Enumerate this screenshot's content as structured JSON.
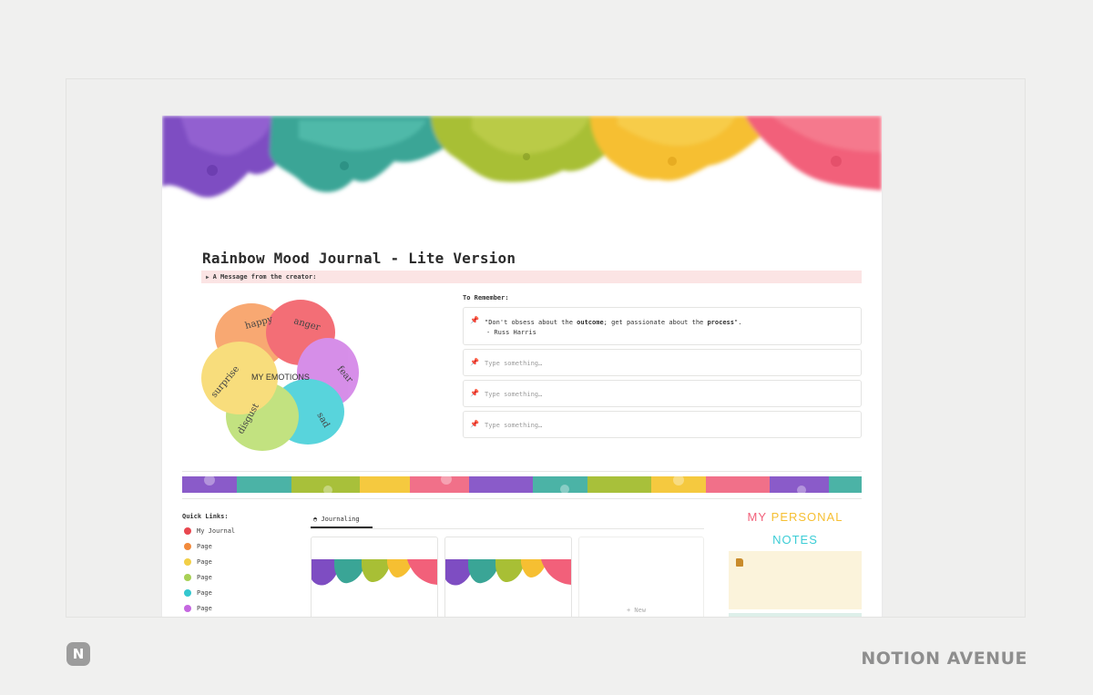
{
  "page": {
    "title": "Rainbow Mood Journal - Lite Version",
    "creator_toggle": "A Message from the creator:",
    "emotions_wheel": {
      "center_label": "MY EMOTIONS",
      "petals": [
        {
          "label": "happy",
          "color": "#f79a5a"
        },
        {
          "label": "anger",
          "color": "#f2555f"
        },
        {
          "label": "fear",
          "color": "#d07be5"
        },
        {
          "label": "sad",
          "color": "#3ccdd6"
        },
        {
          "label": "disgust",
          "color": "#b8dd6a"
        },
        {
          "label": "surprise",
          "color": "#f7d866"
        }
      ]
    },
    "to_remember": {
      "label": "To Remember:",
      "quote_pre": "\"Don't obsess about the ",
      "quote_bold1": "outcome",
      "quote_mid": "; get passionate about the ",
      "quote_bold2": "process",
      "quote_post": "\".",
      "quote_author": "- Russ Harris",
      "placeholders": [
        "Type something…",
        "Type something…",
        "Type something…"
      ]
    },
    "quick_links": {
      "title": "Quick Links:",
      "items": [
        {
          "label": "My Journal",
          "color": "#e8474f"
        },
        {
          "label": "Page",
          "color": "#f28a3c"
        },
        {
          "label": "Page",
          "color": "#f2cf46"
        },
        {
          "label": "Page",
          "color": "#a8d055"
        },
        {
          "label": "Page",
          "color": "#34c7cf"
        },
        {
          "label": "Page",
          "color": "#c567e0"
        }
      ]
    },
    "gallery": {
      "tab_label": "Journaling",
      "new_label": "+ New"
    },
    "notes": {
      "word1": "MY",
      "word2": "PERSONAL",
      "word3": "NOTES"
    }
  },
  "footer": {
    "brand": "NOTION AVENUE",
    "logo_glyph": "N"
  },
  "colors": {
    "purple": "#7d4fc0",
    "teal": "#3aa89d",
    "green": "#a9c23a",
    "yellow": "#f5c33e",
    "pink": "#f0637a"
  }
}
